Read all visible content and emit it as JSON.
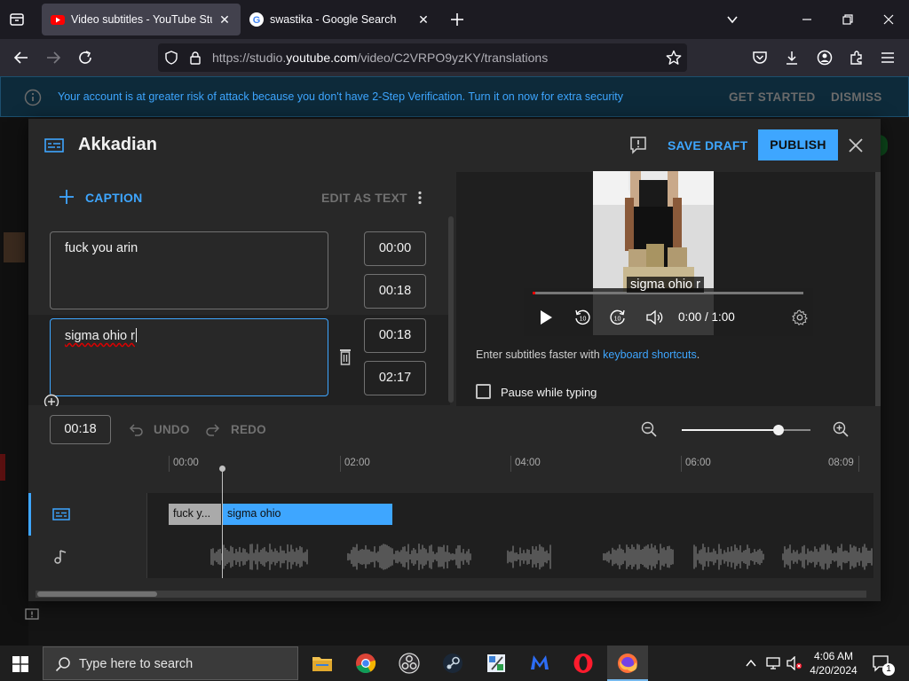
{
  "browser": {
    "tabs": [
      {
        "title": "Video subtitles - YouTube Studi",
        "active": true,
        "favicon": "youtube-icon"
      },
      {
        "title": "swastika - Google Search",
        "active": false,
        "favicon": "google-icon"
      }
    ],
    "url_prefix": "https://studio.",
    "url_domain": "youtube.com",
    "url_path": "/video/C2VRPO9yzKY/translations"
  },
  "banner": {
    "message": "Your account is at greater risk of attack because you don't have 2-Step Verification. Turn it on now for extra security",
    "get_started": "GET STARTED",
    "dismiss": "DISMISS"
  },
  "dialog": {
    "title": "Akkadian",
    "save_draft": "SAVE DRAFT",
    "publish": "PUBLISH",
    "add_caption": "CAPTION",
    "edit_as_text": "EDIT AS TEXT",
    "captions": [
      {
        "text": "fuck you arin",
        "start": "00:00",
        "end": "00:18"
      },
      {
        "text": "sigma ohio r",
        "start": "00:18",
        "end": "02:17"
      }
    ],
    "hint_prefix": "Enter subtitles faster with ",
    "hint_link": "keyboard shortcuts",
    "hint_suffix": ".",
    "pause_while_typing": "Pause while typing",
    "player": {
      "subtitle": "sigma ohio r",
      "time": "0:00 / 1:00",
      "progress": 0.01
    },
    "timeline": {
      "current_time": "00:18",
      "undo": "UNDO",
      "redo": "REDO",
      "ruler_labels": [
        "00:00",
        "02:00",
        "04:00",
        "06:00",
        "08:09"
      ],
      "clip1": "fuck y...",
      "clip2": "sigma ohio",
      "zoom_level": 0.75
    }
  },
  "taskbar": {
    "search_placeholder": "Type here to search",
    "time": "4:06 AM",
    "date": "4/20/2024",
    "notification_count": "1"
  },
  "colors": {
    "accent": "#3ea6ff",
    "dialog_bg": "#282828",
    "browser_bg": "#1c1b22"
  }
}
